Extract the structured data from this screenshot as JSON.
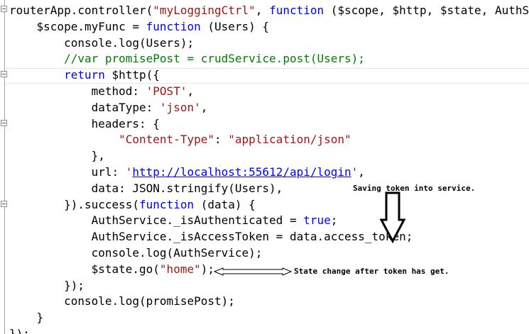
{
  "code_lines": [
    [
      {
        "t": "routerApp.controller(",
        "c": ""
      },
      {
        "t": "\"myLoggingCtrl\"",
        "c": "str"
      },
      {
        "t": ", ",
        "c": ""
      },
      {
        "t": "function",
        "c": "kw"
      },
      {
        "t": " ($scope, $http, $state, AuthSer",
        "c": ""
      }
    ],
    [
      {
        "t": "    $scope.myFunc = ",
        "c": ""
      },
      {
        "t": "function",
        "c": "kw"
      },
      {
        "t": " (Users) {",
        "c": ""
      }
    ],
    [
      {
        "t": "        console.log(Users);",
        "c": ""
      }
    ],
    [
      {
        "t": "        //var promisePost = crudService.post(Users);",
        "c": "cm"
      }
    ],
    [
      {
        "t": "        ",
        "c": ""
      },
      {
        "t": "return",
        "c": "kw"
      },
      {
        "t": " $http({",
        "c": ""
      }
    ],
    [
      {
        "t": "            method: ",
        "c": ""
      },
      {
        "t": "'POST'",
        "c": "str"
      },
      {
        "t": ",",
        "c": ""
      }
    ],
    [
      {
        "t": "            dataType: ",
        "c": ""
      },
      {
        "t": "'json'",
        "c": "str"
      },
      {
        "t": ",",
        "c": ""
      }
    ],
    [
      {
        "t": "            headers: {",
        "c": ""
      }
    ],
    [
      {
        "t": "                ",
        "c": ""
      },
      {
        "t": "\"Content-Type\"",
        "c": "str"
      },
      {
        "t": ": ",
        "c": ""
      },
      {
        "t": "\"application/json\"",
        "c": "str"
      }
    ],
    [
      {
        "t": "            },",
        "c": ""
      }
    ],
    [
      {
        "t": "            url: ",
        "c": ""
      },
      {
        "t": "'",
        "c": "str"
      },
      {
        "t": "http://localhost:55612/api/login",
        "c": "url"
      },
      {
        "t": "'",
        "c": "str"
      },
      {
        "t": ",",
        "c": ""
      }
    ],
    [
      {
        "t": "            data: JSON.stringify(Users),",
        "c": ""
      }
    ],
    [
      {
        "t": "        }).success(",
        "c": ""
      },
      {
        "t": "function",
        "c": "kw"
      },
      {
        "t": " (data) {",
        "c": ""
      }
    ],
    [
      {
        "t": "            AuthService._isAuthenticated = ",
        "c": ""
      },
      {
        "t": "true",
        "c": "kw"
      },
      {
        "t": ";",
        "c": ""
      }
    ],
    [
      {
        "t": "            AuthService._isAccessToken = data.access_token;",
        "c": ""
      }
    ],
    [
      {
        "t": "            console.log(AuthService);",
        "c": ""
      }
    ],
    [
      {
        "t": "            $state.go(",
        "c": ""
      },
      {
        "t": "\"home\"",
        "c": "str"
      },
      {
        "t": ");",
        "c": ""
      }
    ],
    [
      {
        "t": "        });",
        "c": ""
      }
    ],
    [
      {
        "t": "        console.log(promisePost);",
        "c": ""
      }
    ],
    [
      {
        "t": "    }",
        "c": ""
      }
    ],
    [
      {
        "t": "});",
        "c": ""
      }
    ]
  ],
  "annotations": {
    "saving_token": "Saving token into service.",
    "state_change": "State change after token has get."
  },
  "colors": {
    "keyword": "#0000ff",
    "string": "#a31515",
    "comment": "#008000"
  },
  "icons": [
    "fold-collapse-icon",
    "down-arrow-icon",
    "left-arrow-icon"
  ]
}
